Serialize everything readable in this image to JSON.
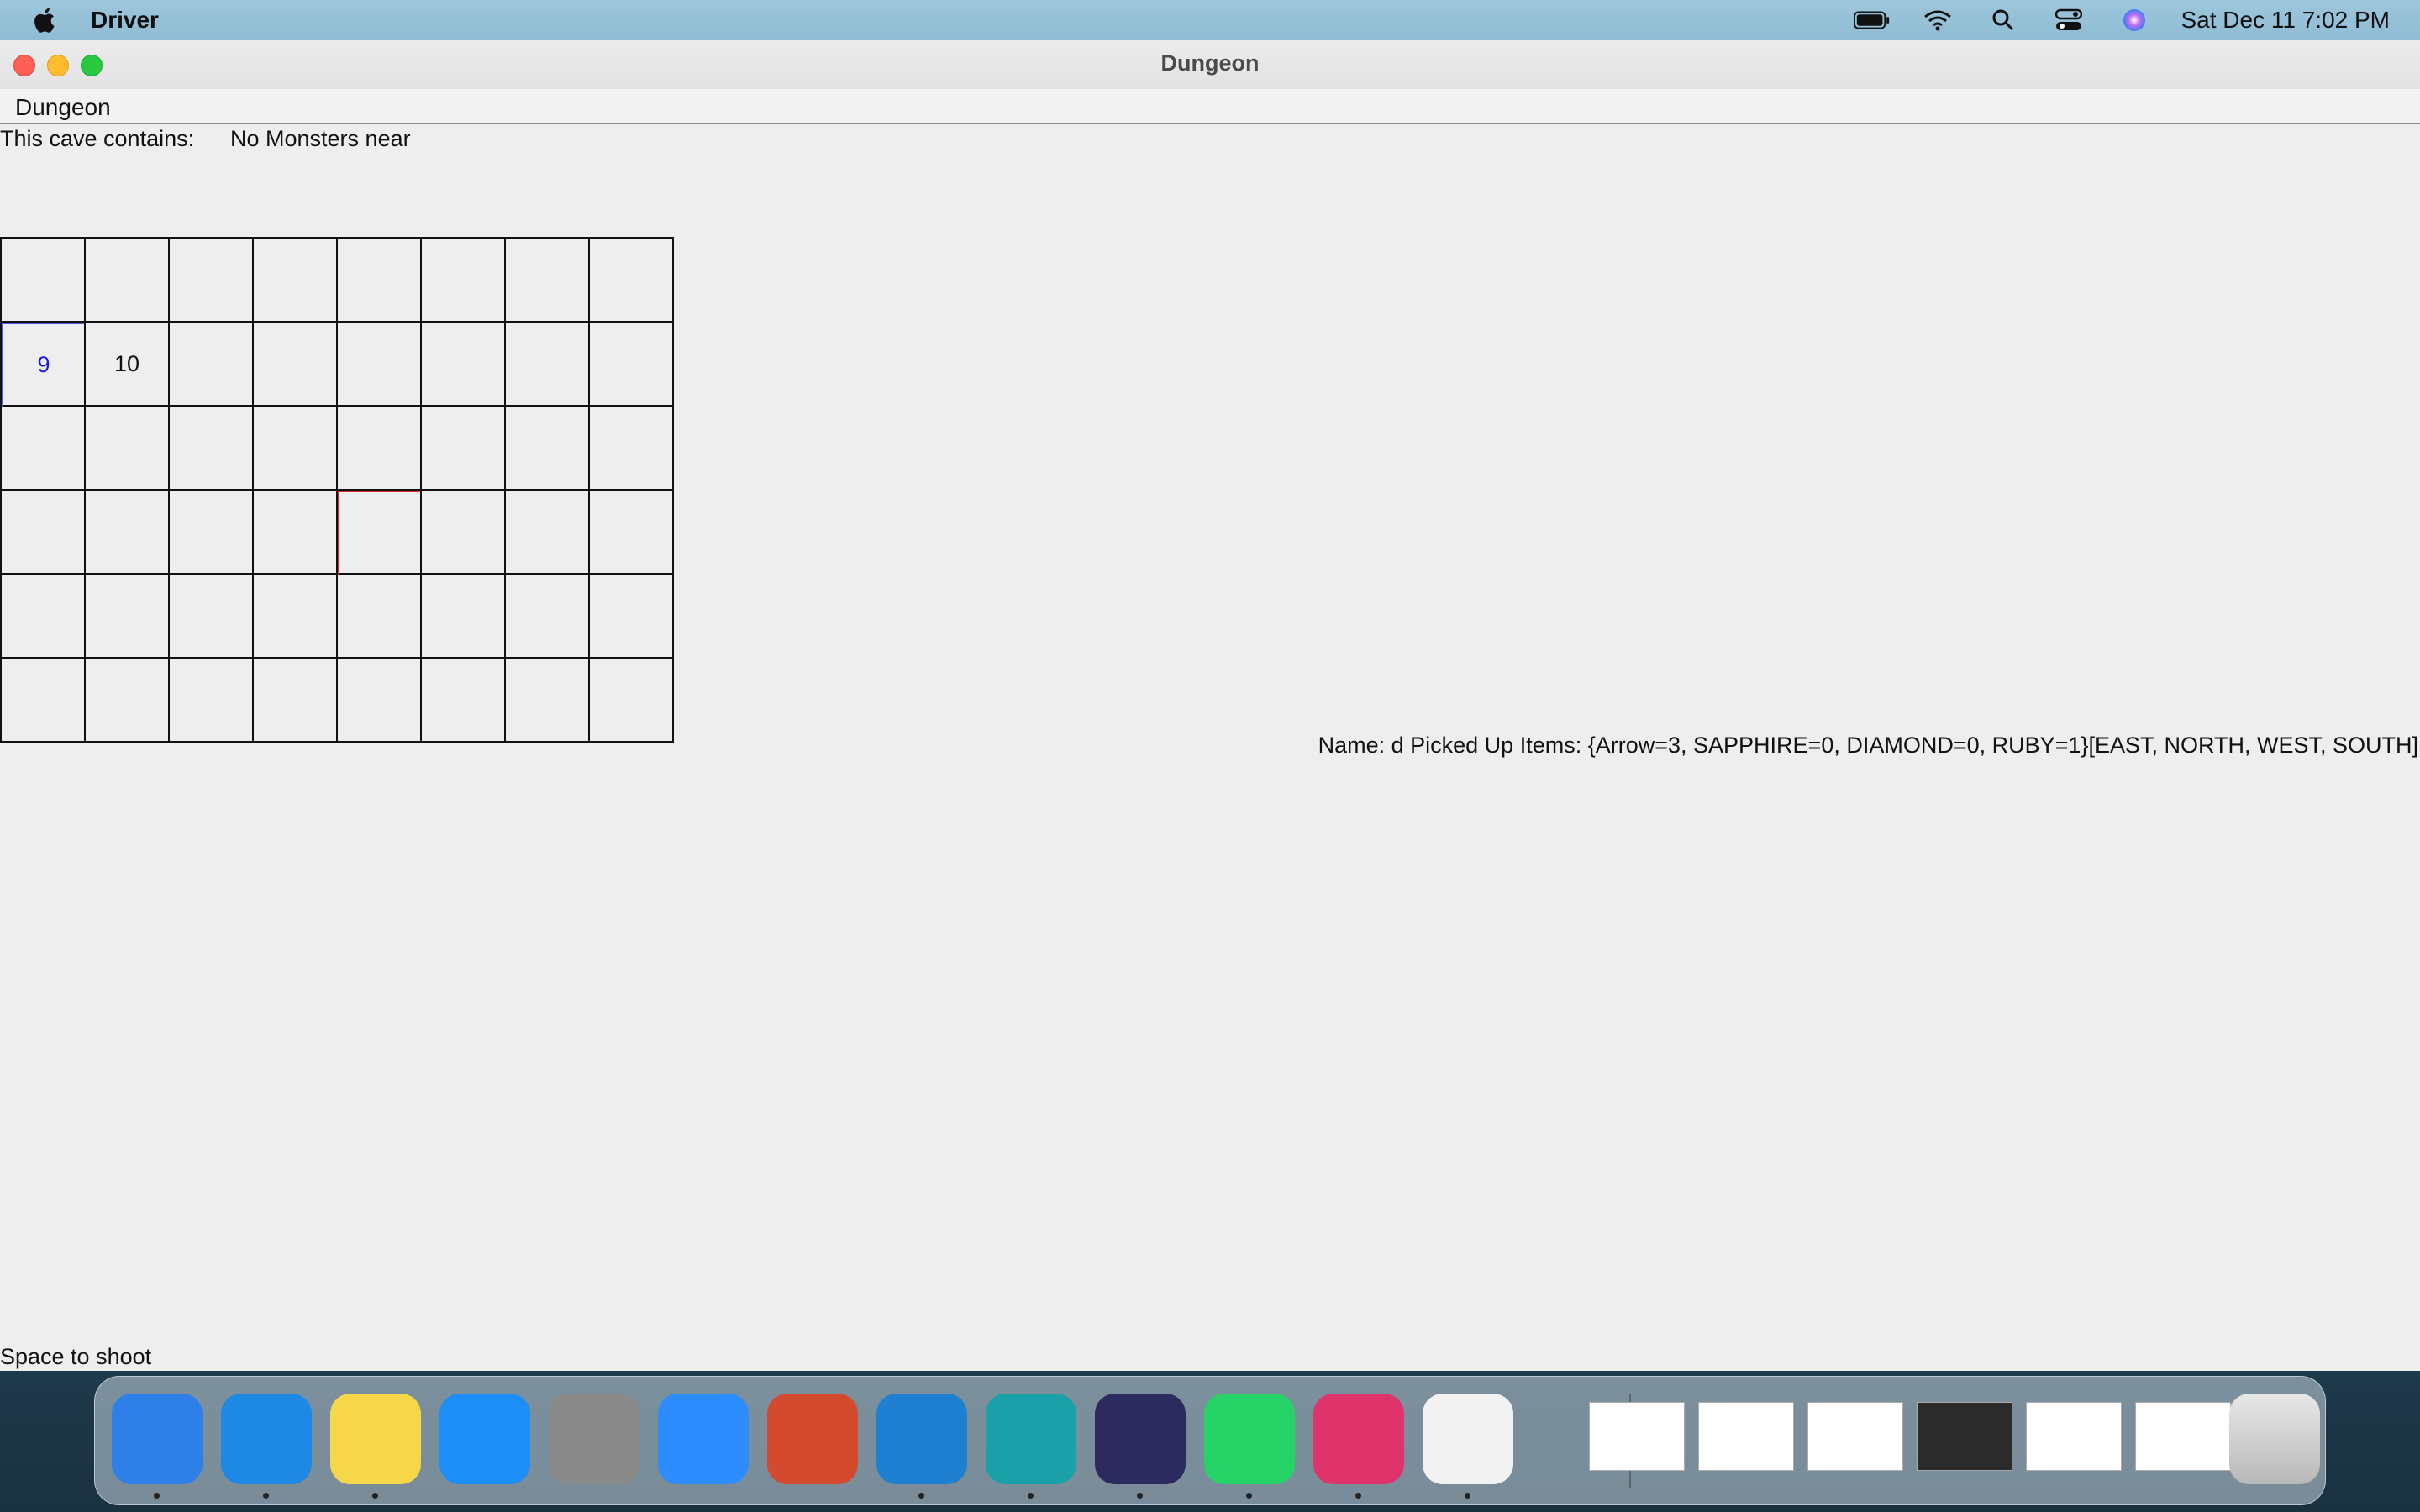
{
  "menubar": {
    "app_name": "Driver",
    "clock": "Sat Dec 11  7:02 PM",
    "icons": [
      "apple-icon",
      "battery-icon",
      "wifi-icon",
      "spotlight-icon",
      "control-center-icon",
      "siri-icon"
    ]
  },
  "window": {
    "title": "Dungeon",
    "menu": "Dungeon"
  },
  "cave": {
    "label": "This cave contains:",
    "value": "No Monsters near"
  },
  "grid": {
    "rows": 6,
    "cols": 8,
    "labels": {
      "r1c0": "9",
      "r1c1": "10"
    }
  },
  "status": {
    "text": "Name: d Picked Up Items: {Arrow=3, SAPPHIRE=0, DIAMOND=0, RUBY=1}[EAST, NORTH, WEST, SOUTH]"
  },
  "hint": "Space to shoot",
  "dock": {
    "apps": [
      "finder-icon",
      "safari-icon",
      "notes-icon",
      "app-store-icon",
      "system-preferences-icon",
      "zoom-icon",
      "canvas-icon",
      "vscode-icon",
      "edge-icon",
      "eclipse-icon",
      "whatsapp-icon",
      "intellij-icon",
      "java-icon"
    ],
    "colors": [
      "#2f7fe8",
      "#1e88e5",
      "#f7d74a",
      "#1c8ef5",
      "#8a8a8a",
      "#2d8cff",
      "#d34a2f",
      "#1f7fd1",
      "#1aa0a8",
      "#2c2a5e",
      "#25d366",
      "#e0336b",
      "#f2f2f2"
    ],
    "windows": [
      "finder-window-thumb",
      "safari-window-thumb",
      "finder-window-thumb-2",
      "intellij-window-thumb",
      "notes-window-thumb",
      "whatsapp-window-thumb"
    ],
    "trash": "trash-icon"
  }
}
